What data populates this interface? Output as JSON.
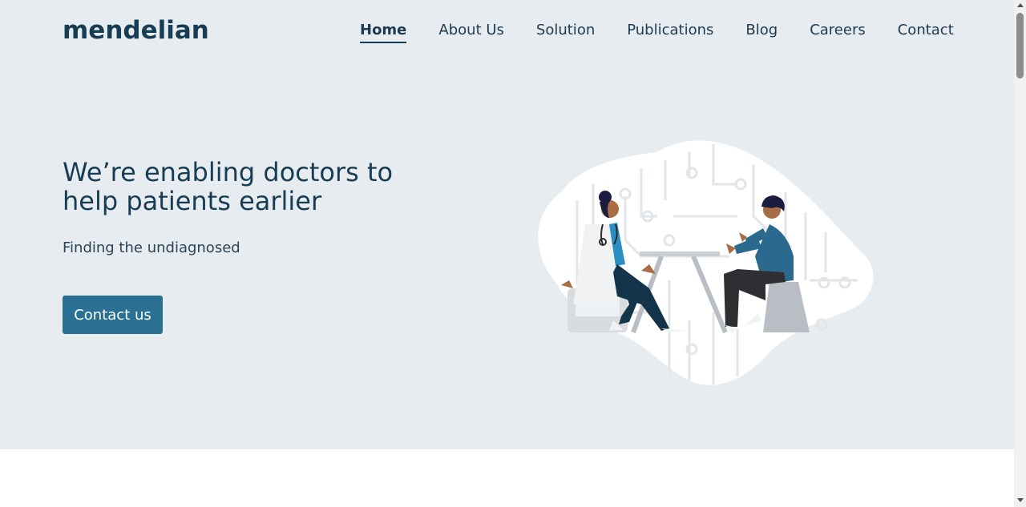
{
  "brand": {
    "logo_text": "mendelian"
  },
  "nav": {
    "items": [
      {
        "label": "Home",
        "active": true
      },
      {
        "label": "About Us"
      },
      {
        "label": "Solution"
      },
      {
        "label": "Publications"
      },
      {
        "label": "Blog"
      },
      {
        "label": "Careers"
      },
      {
        "label": "Contact"
      }
    ]
  },
  "hero": {
    "headline": "We’re enabling doctors to help patients earlier",
    "subtitle": "Finding the undiagnosed",
    "cta_label": "Contact us",
    "illustration_icon": "doctor-patient-consultation-illustration"
  },
  "colors": {
    "hero_background": "#e6ecef",
    "brand_dark": "#173d54",
    "accent": "#2a7093",
    "patient_shirt": "#2b6a8e"
  }
}
